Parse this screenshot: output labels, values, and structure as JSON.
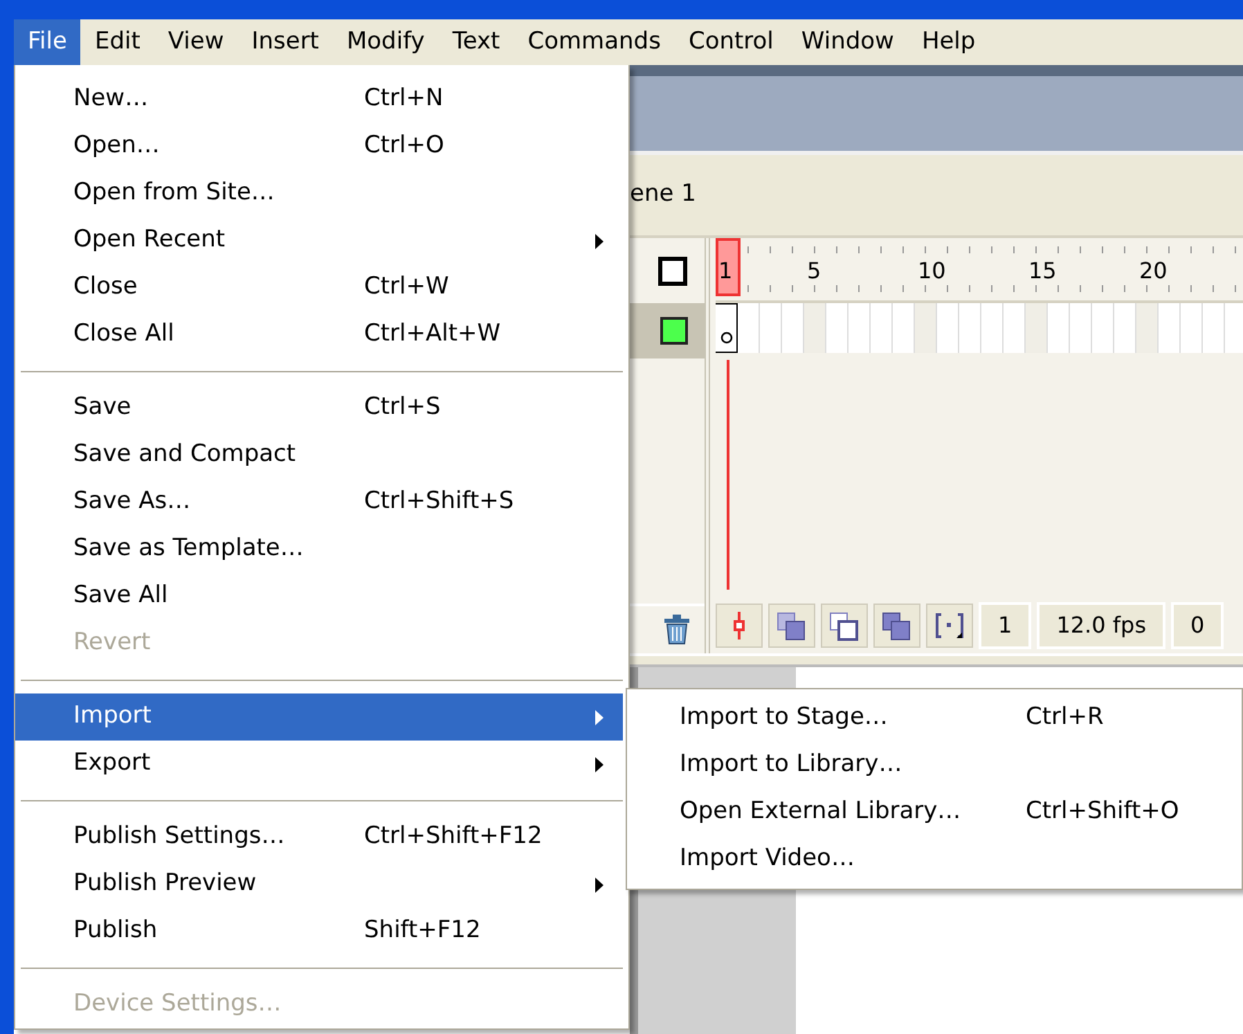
{
  "menubar": [
    {
      "label": "File",
      "selected": true
    },
    {
      "label": "Edit",
      "selected": false
    },
    {
      "label": "View",
      "selected": false
    },
    {
      "label": "Insert",
      "selected": false
    },
    {
      "label": "Modify",
      "selected": false
    },
    {
      "label": "Text",
      "selected": false
    },
    {
      "label": "Commands",
      "selected": false
    },
    {
      "label": "Control",
      "selected": false
    },
    {
      "label": "Window",
      "selected": false
    },
    {
      "label": "Help",
      "selected": false
    }
  ],
  "file_menu": [
    {
      "kind": "item",
      "label": "New…",
      "shortcut": "Ctrl+N",
      "submenu": false,
      "disabled": false,
      "selected": false
    },
    {
      "kind": "item",
      "label": "Open…",
      "shortcut": "Ctrl+O",
      "submenu": false,
      "disabled": false,
      "selected": false
    },
    {
      "kind": "item",
      "label": "Open from Site…",
      "submenu": false,
      "disabled": false,
      "selected": false
    },
    {
      "kind": "item",
      "label": "Open Recent",
      "submenu": true,
      "disabled": false,
      "selected": false
    },
    {
      "kind": "item",
      "label": "Close",
      "shortcut": "Ctrl+W",
      "submenu": false,
      "disabled": false,
      "selected": false
    },
    {
      "kind": "item",
      "label": "Close All",
      "shortcut": "Ctrl+Alt+W",
      "submenu": false,
      "disabled": false,
      "selected": false
    },
    {
      "kind": "separator"
    },
    {
      "kind": "item",
      "label": "Save",
      "shortcut": "Ctrl+S",
      "submenu": false,
      "disabled": false,
      "selected": false
    },
    {
      "kind": "item",
      "label": "Save and Compact",
      "submenu": false,
      "disabled": false,
      "selected": false
    },
    {
      "kind": "item",
      "label": "Save As…",
      "shortcut": "Ctrl+Shift+S",
      "submenu": false,
      "disabled": false,
      "selected": false
    },
    {
      "kind": "item",
      "label": "Save as Template…",
      "submenu": false,
      "disabled": false,
      "selected": false
    },
    {
      "kind": "item",
      "label": "Save All",
      "submenu": false,
      "disabled": false,
      "selected": false
    },
    {
      "kind": "item",
      "label": "Revert",
      "submenu": false,
      "disabled": true,
      "selected": false
    },
    {
      "kind": "separator"
    },
    {
      "kind": "item",
      "label": "Import",
      "submenu": true,
      "disabled": false,
      "selected": true
    },
    {
      "kind": "item",
      "label": "Export",
      "submenu": true,
      "disabled": false,
      "selected": false
    },
    {
      "kind": "separator"
    },
    {
      "kind": "item",
      "label": "Publish Settings…",
      "shortcut": "Ctrl+Shift+F12",
      "submenu": false,
      "disabled": false,
      "selected": false
    },
    {
      "kind": "item",
      "label": "Publish Preview",
      "submenu": true,
      "disabled": false,
      "selected": false
    },
    {
      "kind": "item",
      "label": "Publish",
      "shortcut": "Shift+F12",
      "submenu": false,
      "disabled": false,
      "selected": false
    },
    {
      "kind": "separator"
    },
    {
      "kind": "item",
      "label": "Device Settings…",
      "submenu": false,
      "disabled": true,
      "selected": false
    }
  ],
  "import_submenu": [
    {
      "label": "Import to Stage…",
      "shortcut": "Ctrl+R"
    },
    {
      "label": "Import to Library…"
    },
    {
      "label": "Open External Library…",
      "shortcut": "Ctrl+Shift+O"
    },
    {
      "label": "Import Video…"
    }
  ],
  "scene_bar": {
    "scene": "ene 1"
  },
  "timeline": {
    "frame_numbers": [
      "1",
      "5",
      "10",
      "15",
      "20"
    ],
    "layers": [
      {
        "color": "#4cff4c"
      }
    ],
    "current_frame": "1",
    "frame_rate": "12.0 fps",
    "elapsed_time": "0"
  }
}
